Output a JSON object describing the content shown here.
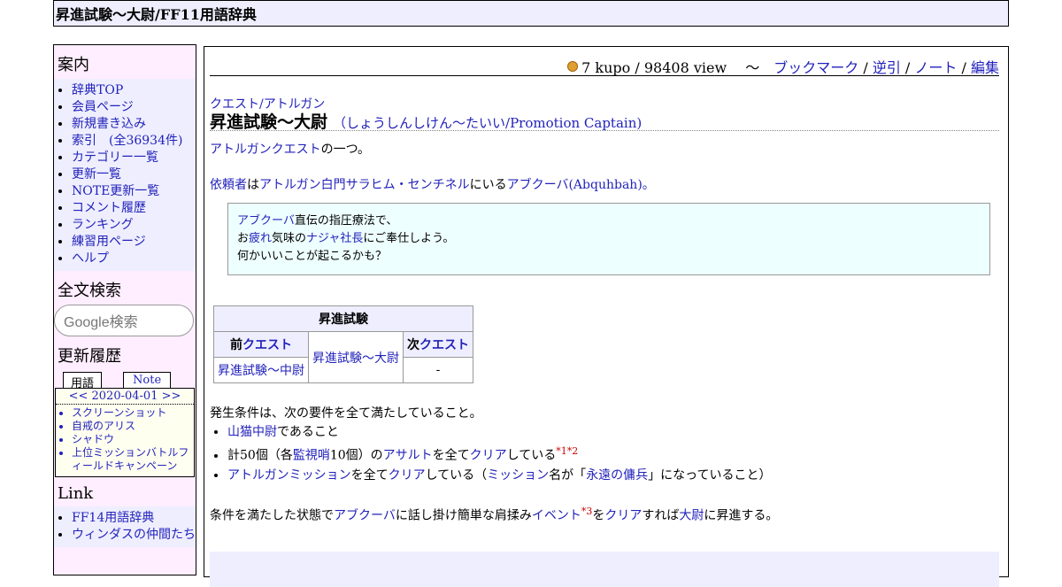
{
  "header": {
    "title": "昇進試験～大尉/FF11用語辞典"
  },
  "sidebar": {
    "guide_heading": "案内",
    "guide_items": [
      "辞典TOP",
      "会員ページ",
      "新規書き込み",
      "索引　(全36934件)",
      "カテゴリー一覧",
      "更新一覧",
      "NOTE更新一覧",
      "コメント履歴",
      "ランキング",
      "練習用ページ",
      "ヘルプ"
    ],
    "search_heading": "全文検索",
    "search_placeholder": "Google検索",
    "recent_heading": "更新履歴",
    "tab_terms": "用語",
    "tab_note": "Note",
    "recent_date": "<< 2020-04-01 >>",
    "recent_items": [
      "スクリーンショット",
      "自戒のアリス",
      "シャドウ",
      "上位ミッションバトルフィールドキャンペーン"
    ],
    "link_heading": "Link",
    "link_items": [
      "FF14用語辞典",
      "ウィンダスの仲間たち"
    ]
  },
  "topbar": {
    "stats": "7 kupo / 98408 view　 ～　",
    "bookmark": "ブックマーク",
    "backlink": "逆引",
    "note": "ノート",
    "edit": "編集",
    "sep": " / "
  },
  "article": {
    "category": "クエスト/アトルガン",
    "title": "昇進試験～大尉",
    "reading": "（しょうしんしけん～たいい/Promotion Captain)",
    "intro_link": "アトルガンクエスト",
    "intro_rest": "の一つ。",
    "client_label": "依頼者",
    "client_is": "は",
    "client_place": "アトルガン白門サラヒム・センチネル",
    "client_at": "にいる",
    "client_name": "アブクーバ",
    "client_roman": "(Abquhbah)。",
    "quote": {
      "l1_link": "アブクーバ",
      "l1_rest": "直伝の指圧療法で、",
      "l2_pre": "お",
      "l2_link1": "疲れ",
      "l2_mid": "気味の",
      "l2_link2": "ナジャ社長",
      "l2_rest": "にご奉仕しよう。",
      "l3": "何かいいことが起こるかも？"
    },
    "table": {
      "heading": "昇進試験",
      "prev_label": "前",
      "prev_link": "クエスト",
      "next_label": "次",
      "next_link": "クエスト",
      "current": "昇進試験～大尉",
      "prev_value": "昇進試験～中尉",
      "next_value": "-"
    },
    "conditions": {
      "lead": "発生条件は、次の要件を全て満たしていること。",
      "c1_link": "山猫中尉",
      "c1_rest": "であること",
      "c2_pre": "計50個（各",
      "c2_link1": "監視哨",
      "c2_mid": "10個）の",
      "c2_link2": "アサルト",
      "c2_mid2": "を全て",
      "c2_link3": "クリア",
      "c2_rest": "している",
      "c2_sup": "*1*2",
      "c3_link1": "アトルガンミッション",
      "c3_mid": "を全て",
      "c3_link2": "クリア",
      "c3_mid2": "している（",
      "c3_link3": "ミッション",
      "c3_mid3": "名が「",
      "c3_link4": "永遠の傭兵",
      "c3_rest": "」になっていること）",
      "after_pre": "条件を満たした状態で",
      "after_link1": "アブクーバ",
      "after_mid": "に話し掛け簡単な肩揉み",
      "after_link2": "イベント",
      "after_sup": "*3",
      "after_mid2": "を",
      "after_link3": "クリア",
      "after_mid3": "すれば",
      "after_link4": "大尉",
      "after_rest": "に昇進する。"
    }
  }
}
